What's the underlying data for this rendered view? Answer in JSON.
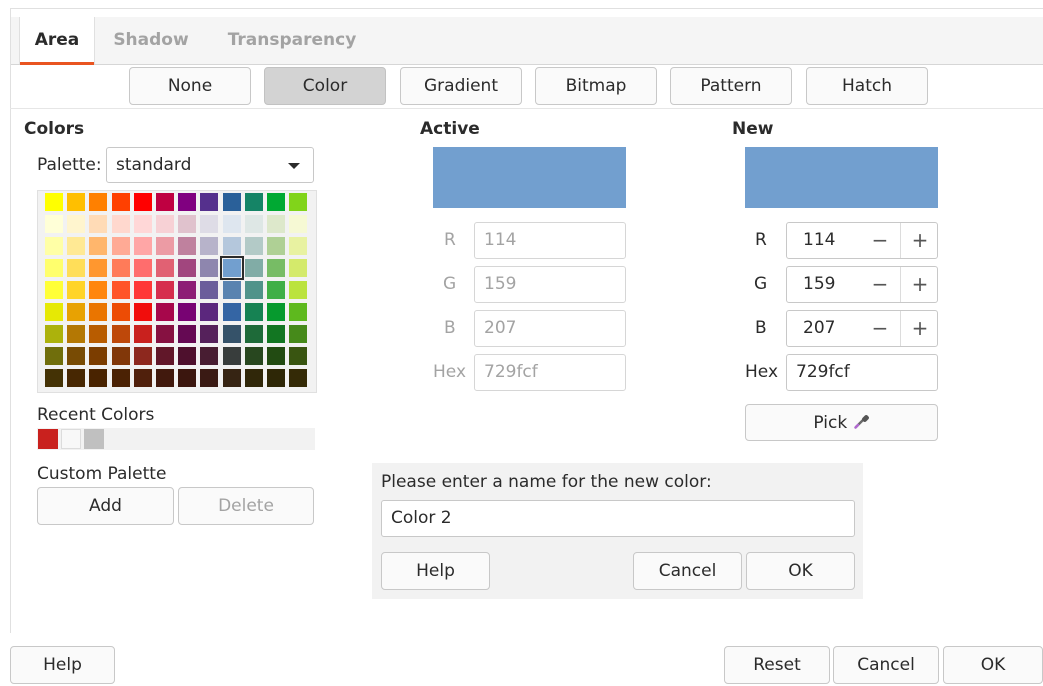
{
  "tabs": [
    "Area",
    "Shadow",
    "Transparency"
  ],
  "fill_buttons": [
    "None",
    "Color",
    "Gradient",
    "Bitmap",
    "Pattern",
    "Hatch"
  ],
  "selected_fill": "Color",
  "colors": {
    "heading": "Colors",
    "palette_label": "Palette:",
    "palette_value": "standard",
    "recent_label": "Recent Colors",
    "custom_palette_label": "Custom Palette",
    "add_label": "Add",
    "delete_label": "Delete",
    "recent_colors": [
      "#c9211e",
      "#f8f8f8",
      "#c0c0c0"
    ],
    "selected_color": "#729fcf",
    "grid": [
      [
        "#ffff00",
        "#ffbf00",
        "#ff8000",
        "#ff4000",
        "#ff0000",
        "#bf0041",
        "#800080",
        "#55308d",
        "#2a6099",
        "#158466",
        "#00a933",
        "#81d41a"
      ],
      [
        "#ffffd7",
        "#fff5ce",
        "#ffdbb6",
        "#ffd8ce",
        "#ffd7d7",
        "#f7d1d5",
        "#e0c2cd",
        "#dedce6",
        "#dee6ef",
        "#dee7e5",
        "#dde8cb",
        "#f6f9d4"
      ],
      [
        "#ffffa6",
        "#ffe994",
        "#ffb66c",
        "#ffaa95",
        "#ffa6a6",
        "#ec9ba4",
        "#bf819e",
        "#b7b3ca",
        "#b4c7dc",
        "#b3cac7",
        "#afd095",
        "#e8f2a1"
      ],
      [
        "#ffff6d",
        "#ffde59",
        "#ff972f",
        "#ff7b59",
        "#ff6d6d",
        "#e16173",
        "#a1467e",
        "#8e86ae",
        "#729fcf",
        "#81aca6",
        "#77bc65",
        "#d4ea6b"
      ],
      [
        "#ffff38",
        "#ffd428",
        "#ff860d",
        "#ff5429",
        "#ff3838",
        "#d62e4e",
        "#8d1d75",
        "#6b5e9b",
        "#5983b0",
        "#50938a",
        "#3faf46",
        "#bbe33d"
      ],
      [
        "#e6e905",
        "#e8a202",
        "#ea7500",
        "#ed4c05",
        "#f10d0c",
        "#a7074b",
        "#780373",
        "#5b277d",
        "#3465a4",
        "#168253",
        "#069a2e",
        "#5eb91e"
      ],
      [
        "#acb20c",
        "#b47804",
        "#b85c00",
        "#be480a",
        "#c9211e",
        "#861141",
        "#650953",
        "#55215b",
        "#355269",
        "#1e6a39",
        "#127622",
        "#468a1a"
      ],
      [
        "#706e0c",
        "#784b04",
        "#7b3d00",
        "#813709",
        "#8d281e",
        "#611729",
        "#4e102d",
        "#481d32",
        "#383d3c",
        "#28471f",
        "#224b12",
        "#395511"
      ],
      [
        "#443205",
        "#472702",
        "#492300",
        "#4b2204",
        "#50200c",
        "#41190d",
        "#3b160e",
        "#3a1a14",
        "#362413",
        "#302709",
        "#2e2706",
        "#342a06"
      ]
    ]
  },
  "active": {
    "heading": "Active",
    "swatch": "#729fcf",
    "r_label": "R",
    "r": "114",
    "g_label": "G",
    "g": "159",
    "b_label": "B",
    "b": "207",
    "hex_label": "Hex",
    "hex": "729fcf"
  },
  "new": {
    "heading": "New",
    "swatch": "#729fcf",
    "r_label": "R",
    "r": "114",
    "g_label": "G",
    "g": "159",
    "b_label": "B",
    "b": "207",
    "hex_label": "Hex",
    "hex": "729fcf",
    "minus": "−",
    "plus": "+",
    "pick_label": "Pick"
  },
  "name_dialog": {
    "prompt": "Please enter a name for the new color:",
    "value": "Color 2",
    "help": "Help",
    "cancel": "Cancel",
    "ok": "OK"
  },
  "footer": {
    "help": "Help",
    "reset": "Reset",
    "cancel": "Cancel",
    "ok": "OK"
  }
}
